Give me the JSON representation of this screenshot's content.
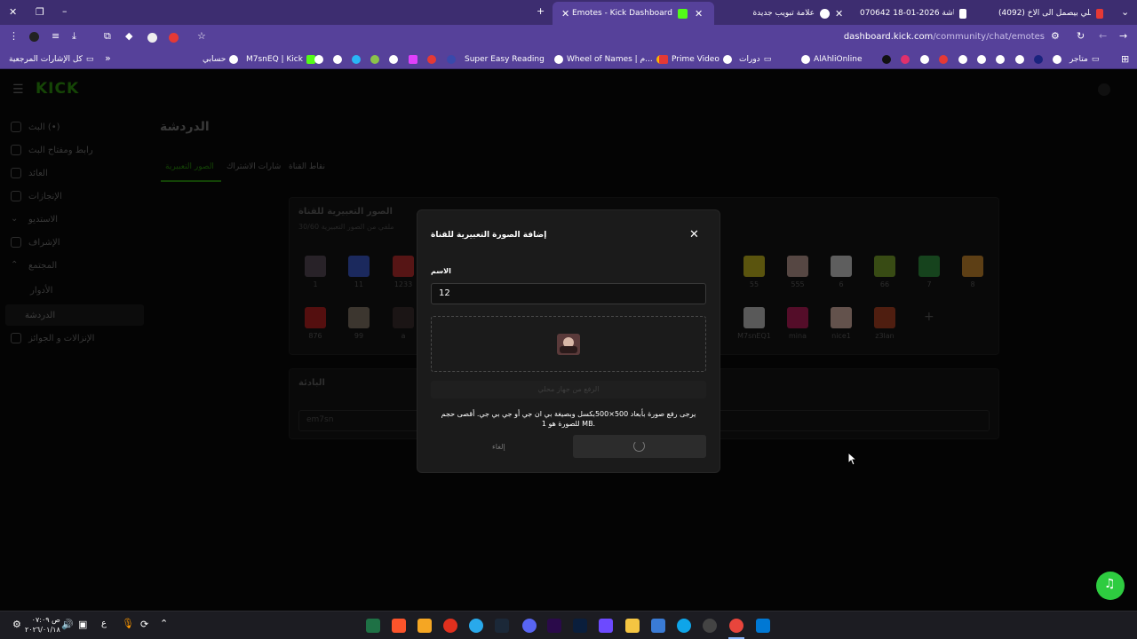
{
  "browser": {
    "tabs": [
      {
        "title": "(4092) مين اللي بيصمل الى الاخ...",
        "color": "#e53935"
      },
      {
        "title": "لقطة شاشة 2026-01-18 070642",
        "color": "#ffffff"
      },
      {
        "title": "علامة تبويب جديدة",
        "color": "#ffffff"
      },
      {
        "title": "Emotes - Kick Dashboard",
        "color": "#53fc18"
      }
    ],
    "url_domain": "dashboard.kick.com",
    "url_path": "/community/chat/emotes",
    "bookmarks_label": "كل الإشارات المرجعية",
    "bookmarks": [
      {
        "label": "حسابي"
      },
      {
        "label": "M7snEQ | Kick"
      },
      {
        "label": "Super Easy Reading"
      },
      {
        "label": "Wheel of Names | م..."
      },
      {
        "label": "Prime Video"
      },
      {
        "label": "دورات"
      },
      {
        "label": "AlAhliOnline"
      },
      {
        "label": "متاجر"
      }
    ]
  },
  "app": {
    "logo": "KICK",
    "logo_color": "#53fc18",
    "page_title": "الدردشة",
    "tabs": [
      {
        "label": "الصور التعبيرية",
        "active": true
      },
      {
        "label": "شارات الاشتراك",
        "active": false
      },
      {
        "label": "نقاط القناة",
        "active": false
      }
    ],
    "sidebar": [
      {
        "label": "البث (•)"
      },
      {
        "label": "رابط ومفتاح البث"
      },
      {
        "label": "العائد"
      },
      {
        "label": "الإنجازات"
      },
      {
        "label": "الاستديو"
      },
      {
        "label": "الإشراف"
      },
      {
        "label": "المجتمع"
      },
      {
        "label": "الأدوار"
      },
      {
        "label": "الدردشة"
      },
      {
        "label": "الإنزالات و الجوائز"
      }
    ],
    "emotes_panel": {
      "title": "الصور التعبيرية للقناة",
      "subtitle": "ملفي من الصور التعبيرية 30/60",
      "emotes": [
        {
          "label": "1",
          "color": "#5a4a5a"
        },
        {
          "label": "11",
          "color": "#3b5bd9"
        },
        {
          "label": "1233",
          "color": "#c92a2a"
        },
        {
          "label": "55",
          "color": "#d4c21a"
        },
        {
          "label": "555",
          "color": "#c9a49a"
        },
        {
          "label": "6",
          "color": "#dcdcdc"
        },
        {
          "label": "66",
          "color": "#7fae28"
        },
        {
          "label": "7",
          "color": "#2e9a3e"
        },
        {
          "label": "8",
          "color": "#d9902a"
        },
        {
          "label": "876",
          "color": "#c21d1d"
        },
        {
          "label": "99",
          "color": "#8a7a6a"
        },
        {
          "label": "a",
          "color": "#3a2a2a"
        },
        {
          "label": "M7snEQ1",
          "color": "#cfcfcf"
        },
        {
          "label": "mina",
          "color": "#c2185b"
        },
        {
          "label": "nice1",
          "color": "#e8c0b0"
        },
        {
          "label": "z3lan",
          "color": "#b8421f"
        }
      ]
    },
    "bio_panel": {
      "title": "البادئة",
      "value": "em7sn"
    }
  },
  "modal": {
    "title": "إضافة الصورة التعبيرية للقناة",
    "name_label": "الاسم",
    "name_value": "12",
    "upload_button": "الرفع من جهاز محلي",
    "hint_line1": "يرجى رفع صورة بأبعاد 500×500بكسل وبصيغة بي ان جي أو جي بي جي. أقصى حجم",
    "hint_line2": "للصورة هو 1 MB.",
    "cancel_label": "إلغاء"
  },
  "taskbar": {
    "time": "۰۷:۰۹ ص",
    "date": "٢٠٢٦/٠١/١٨"
  }
}
